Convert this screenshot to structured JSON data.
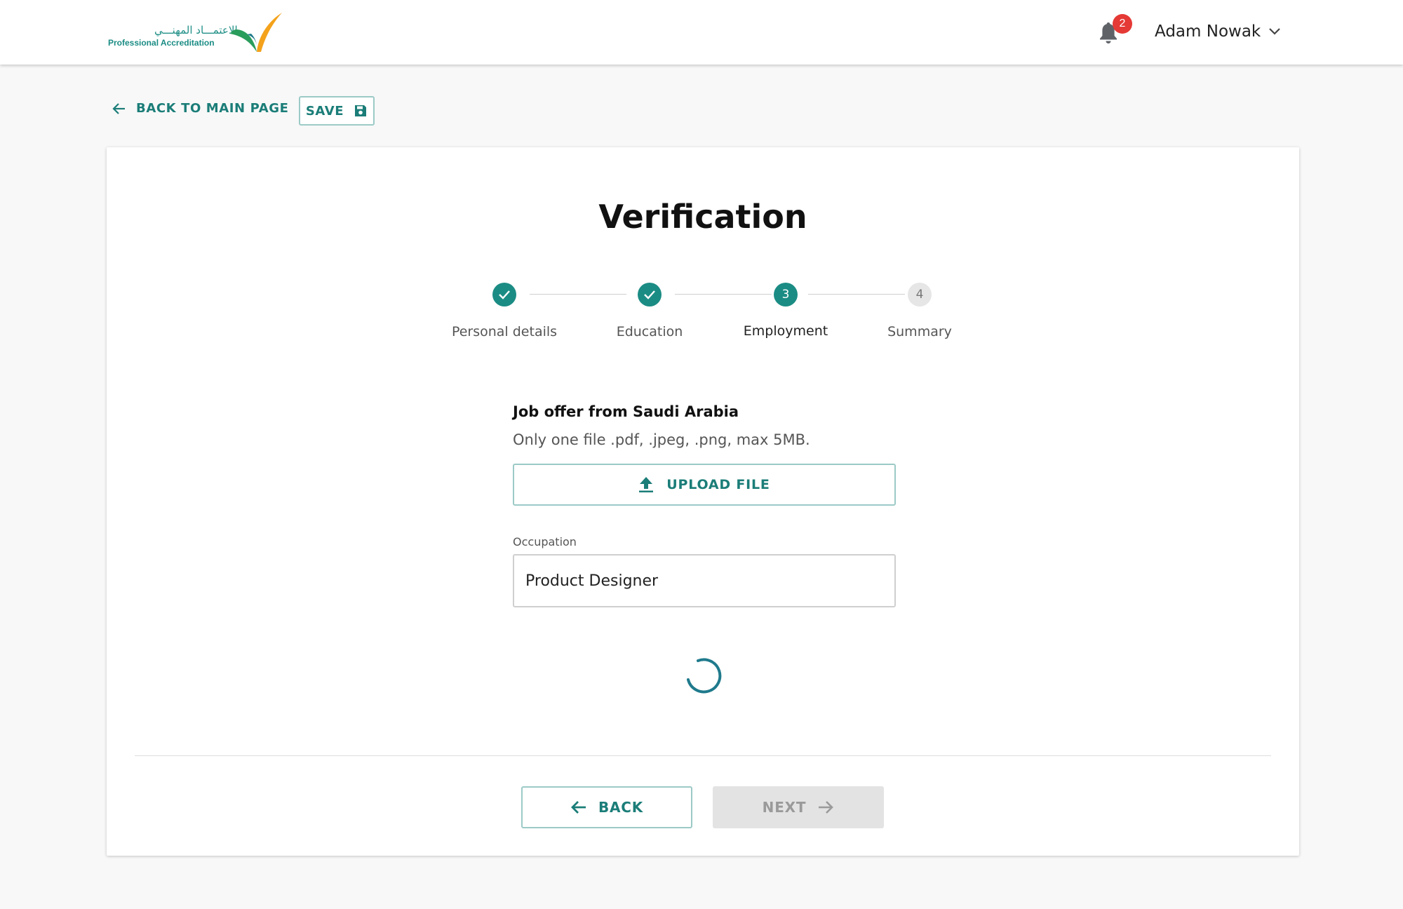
{
  "header": {
    "logo_arabic": "الاعتمـــاد المهنـــي",
    "logo_english": "Professional Accreditation",
    "notification_count": "2",
    "user_name": "Adam Nowak"
  },
  "toolbar": {
    "back_label": "BACK TO MAIN PAGE",
    "save_label": "SAVE"
  },
  "page": {
    "title": "Verification"
  },
  "steps": [
    {
      "number": "1",
      "label": "Personal details",
      "state": "done"
    },
    {
      "number": "2",
      "label": "Education",
      "state": "done"
    },
    {
      "number": "3",
      "label": "Employment",
      "state": "active"
    },
    {
      "number": "4",
      "label": "Summary",
      "state": "pending"
    }
  ],
  "form": {
    "section_title": "Job offer from Saudi Arabia",
    "hint": "Only one file .pdf, .jpeg, .png, max 5MB.",
    "upload_label": "UPLOAD FILE",
    "occupation_label": "Occupation",
    "occupation_value": "Product Designer"
  },
  "footer": {
    "back_label": "BACK",
    "next_label": "NEXT"
  },
  "colors": {
    "accent": "#1b8c84",
    "badge": "#e53935",
    "disabled": "#e3e3e3"
  }
}
